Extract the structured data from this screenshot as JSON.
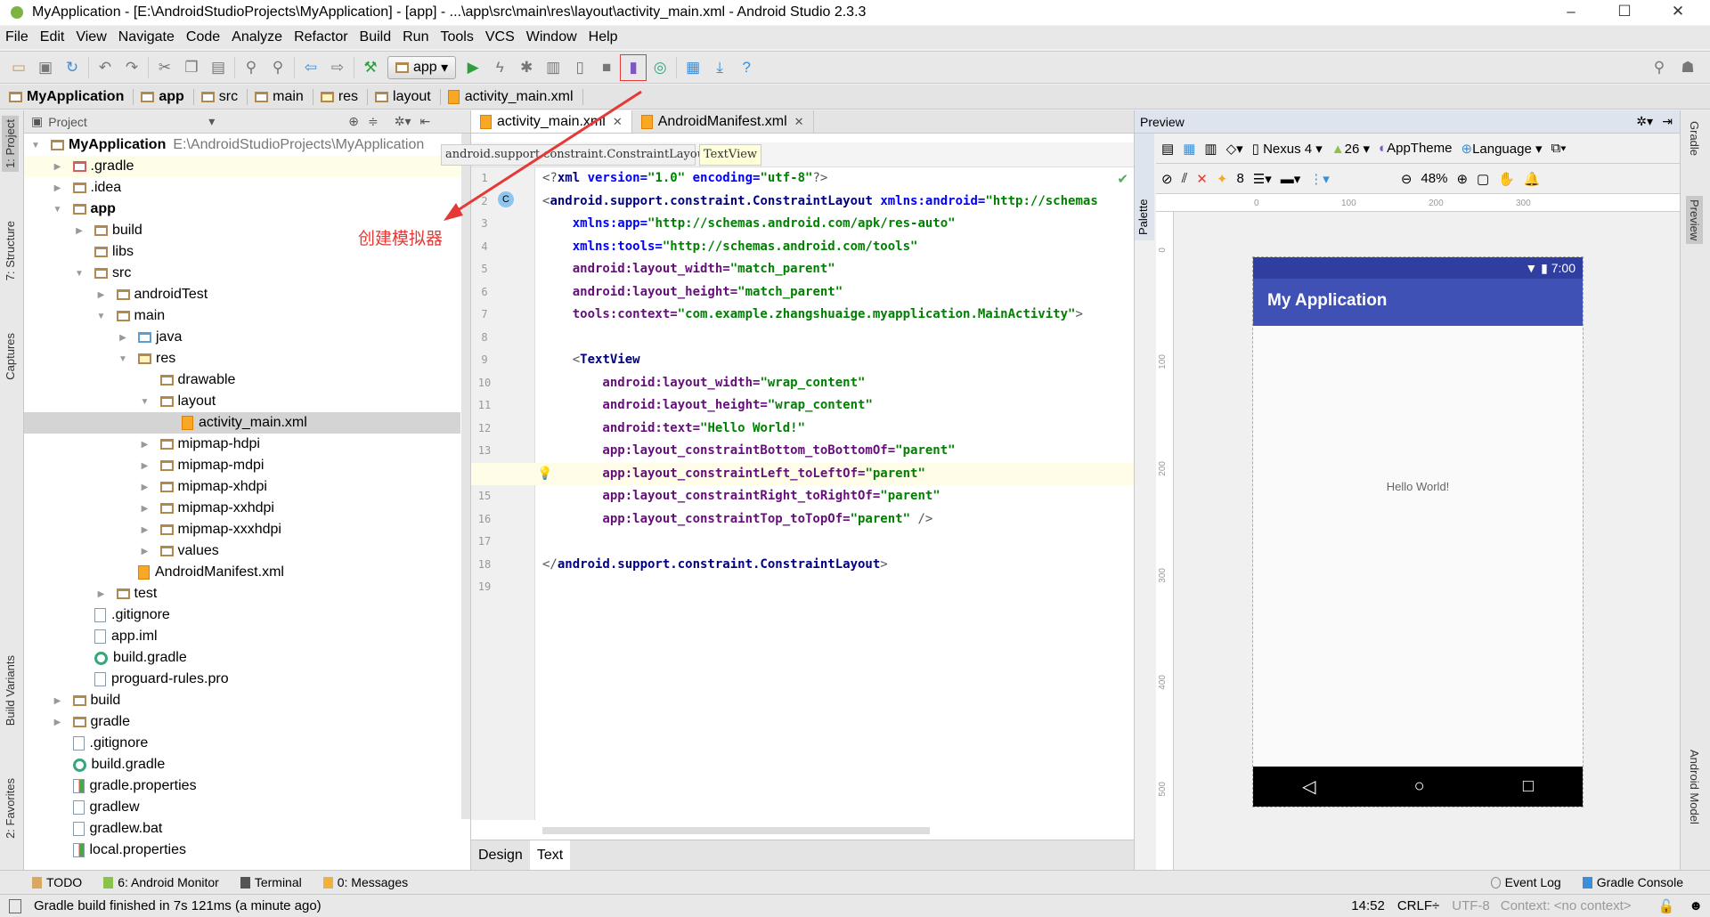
{
  "window": {
    "title": "MyApplication - [E:\\AndroidStudioProjects\\MyApplication] - [app] - ...\\app\\src\\main\\res\\layout\\activity_main.xml - Android Studio 2.3.3",
    "minimize": "–",
    "maximize": "☐",
    "close": "✕"
  },
  "menu": [
    "File",
    "Edit",
    "View",
    "Navigate",
    "Code",
    "Analyze",
    "Refactor",
    "Build",
    "Run",
    "Tools",
    "VCS",
    "Window",
    "Help"
  ],
  "toolbar": {
    "run_config": "app",
    "highlighted_button": "avd-manager",
    "accent": "#e53935"
  },
  "breadcrumb": [
    "MyApplication",
    "app",
    "src",
    "main",
    "res",
    "layout",
    "activity_main.xml"
  ],
  "left_stripe": [
    "1: Project",
    "7: Structure",
    "Captures",
    "Build Variants",
    "2: Favorites"
  ],
  "right_stripe": [
    "Gradle",
    "Preview",
    "Android Model"
  ],
  "project": {
    "view": "Project",
    "tree": [
      {
        "d": 0,
        "a": "open",
        "i": "folder",
        "t": "MyApplication",
        "b": true,
        "p": "E:\\AndroidStudioProjects\\MyApplication"
      },
      {
        "d": 1,
        "a": "closed",
        "i": "folder-red",
        "t": ".gradle",
        "hover": true
      },
      {
        "d": 1,
        "a": "closed",
        "i": "folder",
        "t": ".idea"
      },
      {
        "d": 1,
        "a": "open",
        "i": "folder",
        "t": "app",
        "b": true
      },
      {
        "d": 2,
        "a": "closed",
        "i": "folder",
        "t": "build"
      },
      {
        "d": 2,
        "a": "none",
        "i": "folder",
        "t": "libs"
      },
      {
        "d": 2,
        "a": "open",
        "i": "folder",
        "t": "src"
      },
      {
        "d": 3,
        "a": "closed",
        "i": "folder",
        "t": "androidTest"
      },
      {
        "d": 3,
        "a": "open",
        "i": "folder",
        "t": "main"
      },
      {
        "d": 4,
        "a": "closed",
        "i": "folder-blue",
        "t": "java"
      },
      {
        "d": 4,
        "a": "open",
        "i": "folder-res",
        "t": "res"
      },
      {
        "d": 5,
        "a": "none",
        "i": "folder",
        "t": "drawable"
      },
      {
        "d": 5,
        "a": "open",
        "i": "folder",
        "t": "layout"
      },
      {
        "d": 6,
        "a": "none",
        "i": "xml",
        "t": "activity_main.xml",
        "sel": true
      },
      {
        "d": 5,
        "a": "closed",
        "i": "folder",
        "t": "mipmap-hdpi"
      },
      {
        "d": 5,
        "a": "closed",
        "i": "folder",
        "t": "mipmap-mdpi"
      },
      {
        "d": 5,
        "a": "closed",
        "i": "folder",
        "t": "mipmap-xhdpi"
      },
      {
        "d": 5,
        "a": "closed",
        "i": "folder",
        "t": "mipmap-xxhdpi"
      },
      {
        "d": 5,
        "a": "closed",
        "i": "folder",
        "t": "mipmap-xxxhdpi"
      },
      {
        "d": 5,
        "a": "closed",
        "i": "folder",
        "t": "values"
      },
      {
        "d": 4,
        "a": "none",
        "i": "xml",
        "t": "AndroidManifest.xml"
      },
      {
        "d": 3,
        "a": "closed",
        "i": "folder",
        "t": "test"
      },
      {
        "d": 2,
        "a": "none",
        "i": "file",
        "t": ".gitignore"
      },
      {
        "d": 2,
        "a": "none",
        "i": "file",
        "t": "app.iml"
      },
      {
        "d": 2,
        "a": "none",
        "i": "gradle",
        "t": "build.gradle"
      },
      {
        "d": 2,
        "a": "none",
        "i": "file",
        "t": "proguard-rules.pro"
      },
      {
        "d": 1,
        "a": "closed",
        "i": "folder",
        "t": "build"
      },
      {
        "d": 1,
        "a": "closed",
        "i": "folder",
        "t": "gradle"
      },
      {
        "d": 1,
        "a": "none",
        "i": "file",
        "t": ".gitignore"
      },
      {
        "d": 1,
        "a": "none",
        "i": "gradle",
        "t": "build.gradle"
      },
      {
        "d": 1,
        "a": "none",
        "i": "props",
        "t": "gradle.properties"
      },
      {
        "d": 1,
        "a": "none",
        "i": "file",
        "t": "gradlew"
      },
      {
        "d": 1,
        "a": "none",
        "i": "file",
        "t": "gradlew.bat"
      },
      {
        "d": 1,
        "a": "none",
        "i": "props",
        "t": "local.properties"
      }
    ]
  },
  "editor": {
    "tabs": [
      {
        "label": "activity_main.xml",
        "active": true
      },
      {
        "label": "AndroidManifest.xml"
      }
    ],
    "xml_breadcrumb": [
      "android.support.constraint.ConstraintLayout",
      "TextView"
    ],
    "current_line": 14,
    "lines": [
      [
        [
          "pl",
          "<?"
        ],
        [
          "tag",
          "xml "
        ],
        [
          "ns",
          "version="
        ],
        [
          "av",
          "\"1.0\" "
        ],
        [
          "ns",
          "encoding="
        ],
        [
          "av",
          "\"utf-8\""
        ],
        [
          "pl",
          "?>"
        ]
      ],
      [
        [
          "pl",
          "<"
        ],
        [
          "tag",
          "android.support.constraint.ConstraintLayout "
        ],
        [
          "ns",
          "xmlns:android="
        ],
        [
          "av",
          "\"http://schemas"
        ]
      ],
      [
        [
          "ns",
          "    xmlns:app="
        ],
        [
          "av",
          "\"http://schemas.android.com/apk/res-auto\""
        ]
      ],
      [
        [
          "ns",
          "    xmlns:tools="
        ],
        [
          "av",
          "\"http://schemas.android.com/tools\""
        ]
      ],
      [
        [
          "an",
          "    android:layout_width="
        ],
        [
          "av",
          "\"match_parent\""
        ]
      ],
      [
        [
          "an",
          "    android:layout_height="
        ],
        [
          "av",
          "\"match_parent\""
        ]
      ],
      [
        [
          "an",
          "    tools:context="
        ],
        [
          "av",
          "\"com.example.zhangshuaige.myapplication.MainActivity\""
        ],
        [
          "pl",
          ">"
        ]
      ],
      [],
      [
        [
          "pl",
          "    <"
        ],
        [
          "tag",
          "TextView"
        ]
      ],
      [
        [
          "an",
          "        android:layout_width="
        ],
        [
          "av",
          "\"wrap_content\""
        ]
      ],
      [
        [
          "an",
          "        android:layout_height="
        ],
        [
          "av",
          "\"wrap_content\""
        ]
      ],
      [
        [
          "an",
          "        android:text="
        ],
        [
          "av",
          "\"Hello World!\""
        ]
      ],
      [
        [
          "an",
          "        app:layout_constraintBottom_toBottomOf="
        ],
        [
          "av",
          "\"parent\""
        ]
      ],
      [
        [
          "an",
          "        app:layout_constraintLeft_toLeftOf="
        ],
        [
          "av",
          "\"parent\""
        ]
      ],
      [
        [
          "an",
          "        app:layout_constraintRight_toRightOf="
        ],
        [
          "av",
          "\"parent\""
        ]
      ],
      [
        [
          "an",
          "        app:layout_constraintTop_toTopOf="
        ],
        [
          "av",
          "\"parent\""
        ],
        [
          "pl",
          " />"
        ]
      ],
      [],
      [
        [
          "pl",
          "</"
        ],
        [
          "tag",
          "android.support.constraint.ConstraintLayout"
        ],
        [
          "pl",
          ">"
        ]
      ],
      []
    ],
    "bottom_tabs": [
      {
        "label": "Design"
      },
      {
        "label": "Text",
        "active": true
      }
    ]
  },
  "preview": {
    "title": "Preview",
    "palette": "Palette",
    "device": "Nexus 4",
    "api": "26",
    "theme": "AppTheme",
    "language": "Language",
    "margin": "8",
    "zoom": "48%",
    "ruler_x": [
      "0",
      "100",
      "200",
      "300"
    ],
    "ruler_y": [
      "0",
      "100",
      "200",
      "300",
      "400",
      "500"
    ],
    "phone": {
      "time": "7:00",
      "app_title": "My Application",
      "text": "Hello World!",
      "status_color": "#303f9f",
      "appbar_color": "#3f51b5"
    }
  },
  "annotation": {
    "text": "创建模拟器",
    "color": "#e53935"
  },
  "tool_windows": {
    "left": [
      "TODO",
      "6: Android Monitor",
      "Terminal",
      "0: Messages"
    ],
    "right": [
      "Event Log",
      "Gradle Console"
    ]
  },
  "status": {
    "message": "Gradle build finished in 7s 121ms (a minute ago)",
    "position": "14:52",
    "line_sep": "CRLF÷",
    "encoding": "UTF-8",
    "context": "Context: <no context>"
  }
}
